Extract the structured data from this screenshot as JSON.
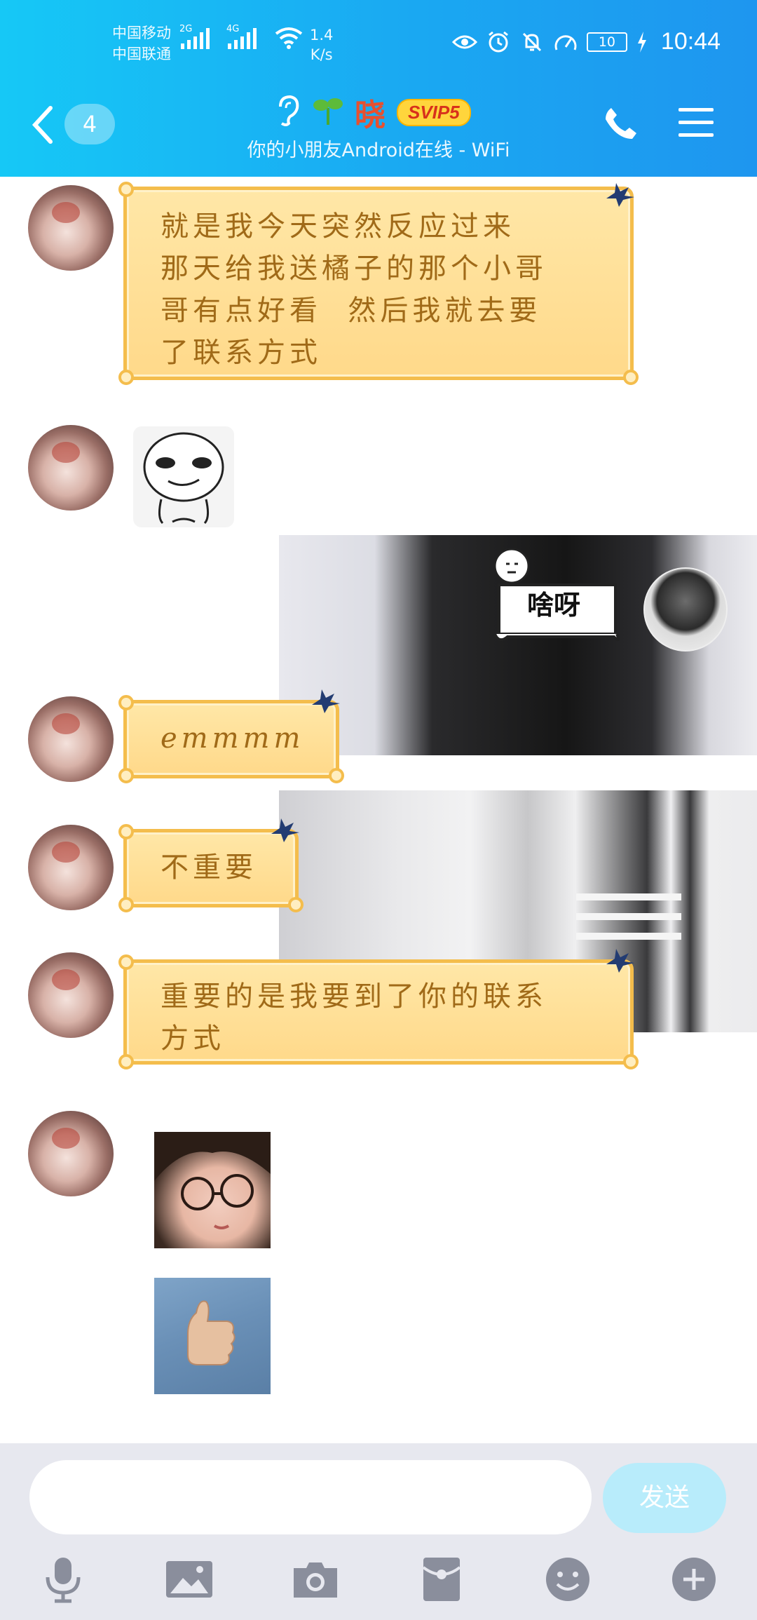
{
  "status_bar": {
    "carrier_1": "中国移动",
    "carrier_2": "中国联通",
    "signal_1_type": "2G",
    "signal_2_type": "4G",
    "speed_value": "1.4",
    "speed_unit": "K/s",
    "battery": "10",
    "time": "10:44"
  },
  "header": {
    "unread_count": "4",
    "contact_name": "晓",
    "vip_badge": "SVIP5",
    "subtitle": "你的小朋友Android在线 - WiFi"
  },
  "messages": [
    {
      "sender": "friend",
      "type": "text",
      "text": "就是我今天突然反应过来\n那天给我送橘子的那个小哥\n哥有点好看  然后我就去要\n了联系方式"
    },
    {
      "sender": "friend",
      "type": "sticker",
      "icon": "smiling-face-sticker"
    },
    {
      "sender": "me",
      "type": "sticker",
      "text": "啥呀"
    },
    {
      "sender": "friend",
      "type": "text",
      "text": "emmmm"
    },
    {
      "sender": "friend",
      "type": "text",
      "text": "不重要"
    },
    {
      "sender": "friend",
      "type": "text",
      "text": "重要的是我要到了你的联系\n方式"
    },
    {
      "sender": "friend",
      "type": "image",
      "icon": "girl-with-glasses-image"
    },
    {
      "sender": "friend",
      "type": "image",
      "icon": "thumbs-up-image"
    }
  ],
  "composer": {
    "input_value": "",
    "send_label": "发送"
  },
  "toolbar_icons": [
    "microphone-icon",
    "picture-icon",
    "camera-icon",
    "red-packet-icon",
    "emoji-icon",
    "plus-icon"
  ],
  "colors": {
    "header_start": "#16c8f6",
    "header_end": "#1e96ef",
    "bubble_fill": "#ffdf96",
    "bubble_border": "#f4bd4c",
    "bubble_text": "#a06a18",
    "name_color": "#e8502f",
    "send_button": "#b8ecfb"
  }
}
